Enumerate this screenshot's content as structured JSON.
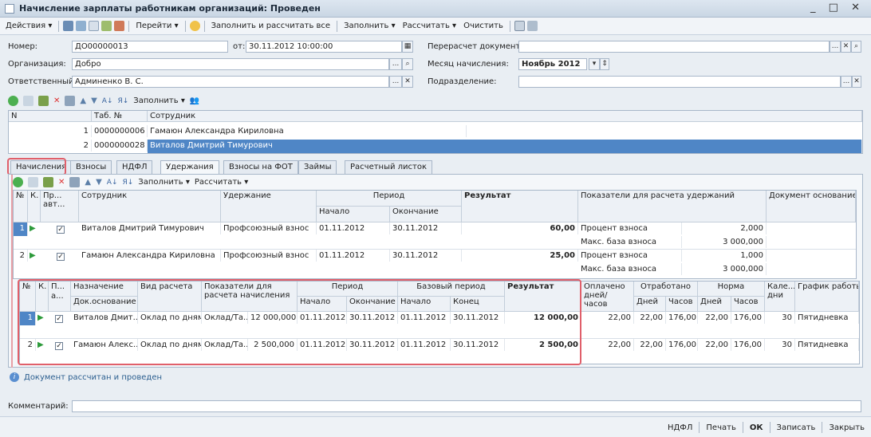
{
  "window": {
    "title": "Начисление зарплаты работникам организаций: Проведен",
    "controls": "_ □ ✕"
  },
  "toolbar": {
    "actions": "Действия ▾",
    "go": "Перейти ▾",
    "fill_calc_all": "Заполнить и рассчитать все",
    "fill": "Заполнить ▾",
    "calculate": "Рассчитать ▾",
    "clear": "Очистить"
  },
  "form": {
    "number_label": "Номер:",
    "number": "ДО00000013",
    "date_label": "от:",
    "date": "30.11.2012 10:00:00",
    "org_label": "Организация:",
    "org": "Добро",
    "resp_label": "Ответственный:",
    "resp": "Админенко В. С.",
    "recalc_label": "Перерасчет документа:",
    "recalc": "",
    "month_label": "Месяц начисления:",
    "month": "Ноябрь 2012",
    "dept_label": "Подразделение:",
    "dept": ""
  },
  "emp_toolbar": {
    "fill": "Заполнить ▾"
  },
  "employees": {
    "headers": [
      "N",
      "Таб. №",
      "Сотрудник"
    ],
    "rows": [
      {
        "n": "1",
        "tab": "0000000006",
        "name": "Гамаюн Александра Кириловна"
      },
      {
        "n": "2",
        "tab": "0000000028",
        "name": "Виталов Дмитрий Тимурович"
      }
    ]
  },
  "tabs": [
    "Начисления",
    "Взносы",
    "НДФЛ",
    "Удержания",
    "Взносы на ФОТ",
    "Займы",
    "Расчетный листок"
  ],
  "ded": {
    "toolbar": {
      "fill": "Заполнить ▾",
      "calculate": "Рассчитать ▾"
    },
    "headers": {
      "n": "№",
      "k": "К.",
      "auto": "Пр... авт...",
      "emp": "Сотрудник",
      "ded": "Удержание",
      "period": "Период",
      "start": "Начало",
      "end": "Окончание",
      "result": "Результат",
      "indicators": "Показатели для расчета удержаний",
      "doc": "Документ основание"
    },
    "rows": [
      {
        "n": "1",
        "emp": "Виталов Дмитрий Тимурович",
        "ded": "Профсоюзный взнос",
        "start": "01.11.2012",
        "end": "30.11.2012",
        "result": "60,00",
        "ind1": "Процент взноса",
        "v1": "2,000",
        "ind2": "Макс. база взноса",
        "v2": "3 000,000"
      },
      {
        "n": "2",
        "emp": "Гамаюн Александра Кириловна",
        "ded": "Профсоюзный взнос",
        "start": "01.11.2012",
        "end": "30.11.2012",
        "result": "25,00",
        "ind1": "Процент взноса",
        "v1": "1,000",
        "ind2": "Макс. база взноса",
        "v2": "3 000,000"
      }
    ]
  },
  "acc": {
    "headers": {
      "n": "№",
      "k": "К.",
      "p": "П... а...",
      "purpose": "Назначение",
      "docbase": "Док.основание",
      "type": "Вид расчета",
      "indicators": "Показатели для расчета начисления",
      "period": "Период",
      "start": "Начало",
      "end": "Окончание",
      "base_period": "Базовый период",
      "bstart": "Начало",
      "bend": "Конец",
      "result": "Результат",
      "paid": "Оплачено дней/часов",
      "worked": "Отработано",
      "days": "Дней",
      "hours": "Часов",
      "norm": "Норма",
      "ndays": "Дней",
      "nhours": "Часов",
      "cal": "Кале... дни",
      "schedule": "График работы"
    },
    "rows": [
      {
        "n": "1",
        "purpose": "Виталов Дмит...",
        "type": "Оклад по дням",
        "ind": "Оклад/Та...",
        "indv": "12 000,000",
        "start": "01.11.2012",
        "end": "30.11.2012",
        "bstart": "01.11.2012",
        "bend": "30.11.2012",
        "result": "12 000,00",
        "paid": "22,00",
        "wd": "22,00",
        "wh": "176,00",
        "nd": "22,00",
        "nh": "176,00",
        "cal": "30",
        "sched": "Пятидневка"
      },
      {
        "n": "2",
        "purpose": "Гамаюн Алекс...",
        "type": "Оклад по дням",
        "ind": "Оклад/Та...",
        "indv": "2 500,000",
        "start": "01.11.2012",
        "end": "30.11.2012",
        "bstart": "01.11.2012",
        "bend": "30.11.2012",
        "result": "2 500,00",
        "paid": "22,00",
        "wd": "22,00",
        "wh": "176,00",
        "nd": "22,00",
        "nh": "176,00",
        "cal": "30",
        "sched": "Пятидневка"
      }
    ]
  },
  "info": "Документ рассчитан и проведен",
  "comment_label": "Комментарий:",
  "comment": "",
  "status": {
    "ndfl": "НДФЛ",
    "print": "Печать",
    "ok": "ОК",
    "save": "Записать",
    "close": "Закрыть"
  },
  "colors": {
    "accent": "#e05f6a",
    "selection": "#4f86c6"
  }
}
